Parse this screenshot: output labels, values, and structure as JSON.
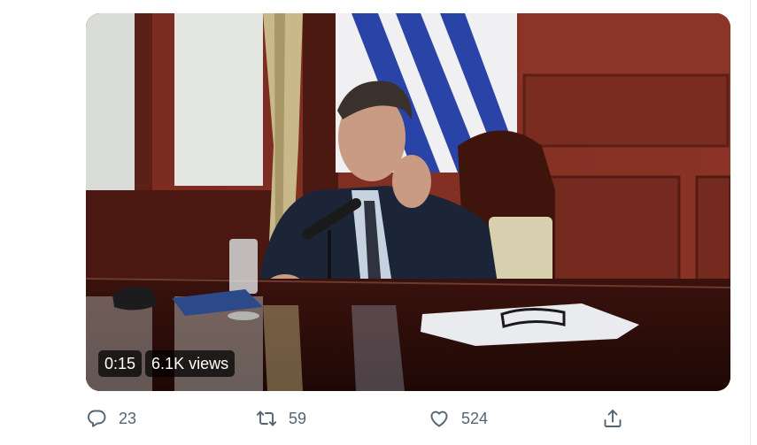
{
  "video": {
    "duration": "0:15",
    "views": "6.1K views"
  },
  "actions": {
    "reply_count": "23",
    "retweet_count": "59",
    "like_count": "524"
  },
  "colors": {
    "icon": "#536471",
    "overlay_bg": "#000000"
  },
  "icons": [
    "reply-icon",
    "retweet-icon",
    "like-icon",
    "share-icon"
  ]
}
